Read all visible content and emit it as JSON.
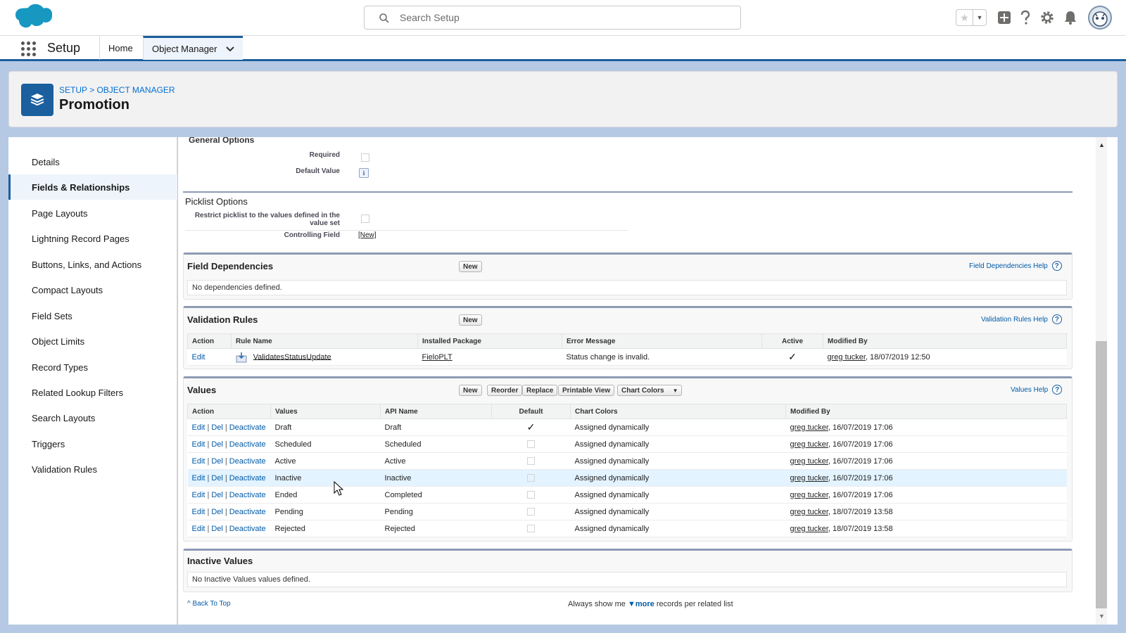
{
  "header": {
    "search_placeholder": "Search Setup",
    "icons": [
      "salesforce-cloud-logo",
      "search-icon",
      "star-icon",
      "chevron-down-icon",
      "add-icon",
      "help-icon",
      "gear-icon",
      "bell-icon",
      "avatar"
    ]
  },
  "nav": {
    "app_title": "Setup",
    "tabs": [
      {
        "label": "Home"
      },
      {
        "label": "Object Manager"
      }
    ]
  },
  "page": {
    "breadcrumb": "SETUP > OBJECT MANAGER",
    "title": "Promotion"
  },
  "sidebar": {
    "items": [
      {
        "label": "Details"
      },
      {
        "label": "Fields & Relationships"
      },
      {
        "label": "Page Layouts"
      },
      {
        "label": "Lightning Record Pages"
      },
      {
        "label": "Buttons, Links, and Actions"
      },
      {
        "label": "Compact Layouts"
      },
      {
        "label": "Field Sets"
      },
      {
        "label": "Object Limits"
      },
      {
        "label": "Record Types"
      },
      {
        "label": "Related Lookup Filters"
      },
      {
        "label": "Search Layouts"
      },
      {
        "label": "Triggers"
      },
      {
        "label": "Validation Rules"
      }
    ]
  },
  "general": {
    "title": "General Options",
    "required_label": "Required",
    "default_value_label": "Default Value",
    "info_glyph": "i"
  },
  "picklist": {
    "title": "Picklist Options",
    "restrict_label_1": "Restrict picklist to the values defined in the",
    "restrict_label_2": "value set",
    "controlling_label": "Controlling Field",
    "controlling_link": "[New]"
  },
  "field_dependencies": {
    "title": "Field Dependencies",
    "new_button": "New",
    "help": "Field Dependencies Help",
    "empty": "No dependencies defined."
  },
  "validation_rules": {
    "title": "Validation Rules",
    "new_button": "New",
    "help": "Validation Rules Help",
    "columns": [
      "Action",
      "Rule Name",
      "Installed Package",
      "Error Message",
      "Active",
      "Modified By"
    ],
    "rows": [
      {
        "action": "Edit",
        "rule_name": "ValidatesStatusUpdate",
        "package": "FieloPLT",
        "error": "Status change is invalid.",
        "active": true,
        "modified_user": "greg tucker",
        "modified_date": ", 18/07/2019 12:50"
      }
    ]
  },
  "values": {
    "title": "Values",
    "buttons": {
      "new": "New",
      "reorder": "Reorder",
      "replace": "Replace",
      "printable": "Printable View",
      "chart_colors": "Chart Colors"
    },
    "help": "Values Help",
    "columns": [
      "Action",
      "Values",
      "API Name",
      "Default",
      "Chart Colors",
      "Modified By"
    ],
    "action_edit": "Edit",
    "action_del": "Del",
    "action_deactivate": "Deactivate",
    "rows": [
      {
        "value": "Draft",
        "api": "Draft",
        "default": true,
        "color": "Assigned dynamically",
        "user": "greg tucker",
        "date": ", 16/07/2019 17:06"
      },
      {
        "value": "Scheduled",
        "api": "Scheduled",
        "default": false,
        "color": "Assigned dynamically",
        "user": "greg tucker",
        "date": ", 16/07/2019 17:06"
      },
      {
        "value": "Active",
        "api": "Active",
        "default": false,
        "color": "Assigned dynamically",
        "user": "greg tucker",
        "date": ", 16/07/2019 17:06"
      },
      {
        "value": "Inactive",
        "api": "Inactive",
        "default": false,
        "color": "Assigned dynamically",
        "user": "greg tucker",
        "date": ", 16/07/2019 17:06"
      },
      {
        "value": "Ended",
        "api": "Completed",
        "default": false,
        "color": "Assigned dynamically",
        "user": "greg tucker",
        "date": ", 16/07/2019 17:06"
      },
      {
        "value": "Pending",
        "api": "Pending",
        "default": false,
        "color": "Assigned dynamically",
        "user": "greg tucker",
        "date": ", 18/07/2019 13:58"
      },
      {
        "value": "Rejected",
        "api": "Rejected",
        "default": false,
        "color": "Assigned dynamically",
        "user": "greg tucker",
        "date": ", 18/07/2019 13:58"
      }
    ]
  },
  "inactive_values": {
    "title": "Inactive Values",
    "empty": "No Inactive Values values defined."
  },
  "footer": {
    "back_to_top": "Back To Top",
    "show_prefix": "Always show me",
    "show_more": "more",
    "show_suffix": "records per related list"
  },
  "colors": {
    "brand_blue": "#1b5f9e",
    "link_blue": "#015ba7",
    "hover_row": "#e3f3ff"
  }
}
